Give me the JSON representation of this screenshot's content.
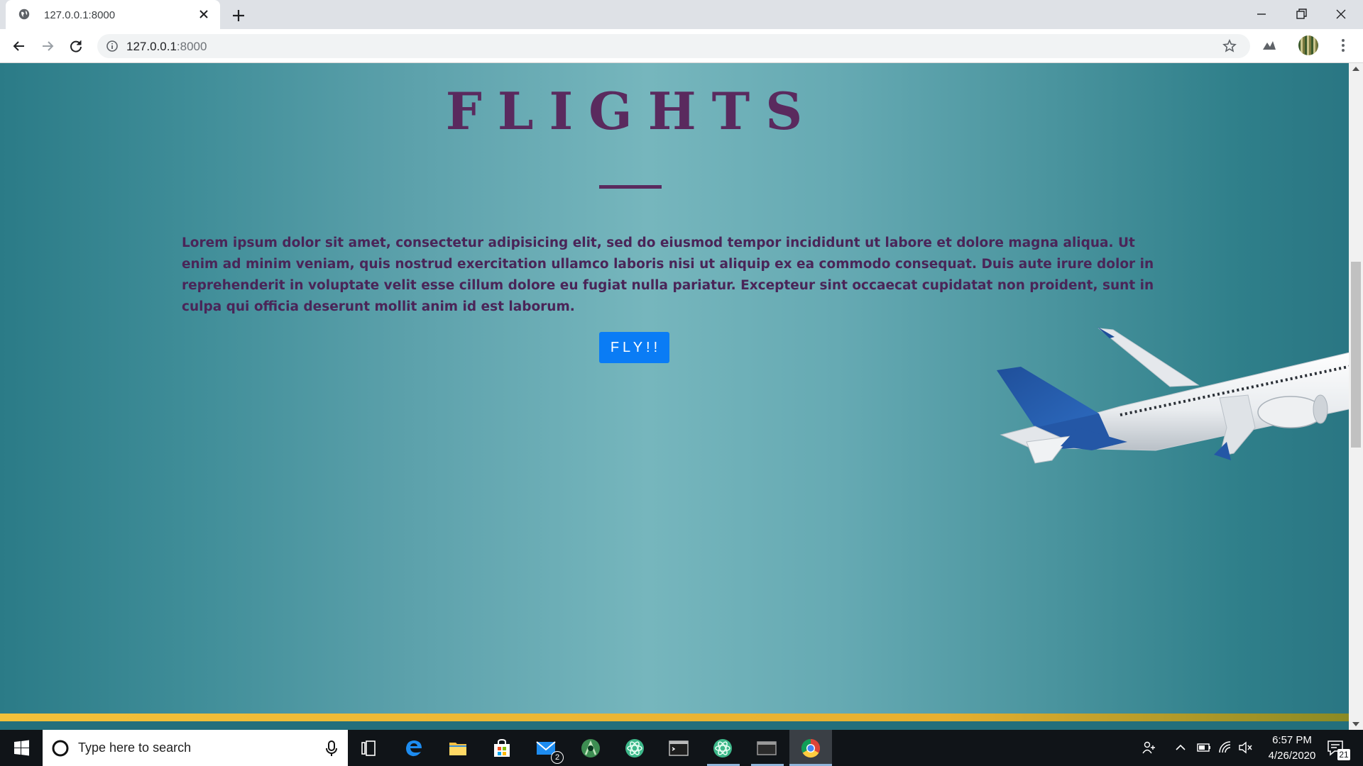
{
  "browser": {
    "tab_title": "127.0.0.1:8000",
    "url_host": "127.0.0.1",
    "url_port": ":8000"
  },
  "page": {
    "heading": "FLIGHTS",
    "body_text": "Lorem ipsum dolor sit amet, consectetur adipisicing elit, sed do eiusmod tempor incididunt ut labore et dolore magna aliqua. Ut enim ad minim veniam, quis nostrud exercitation ullamco laboris nisi ut aliquip ex ea commodo consequat. Duis aute irure dolor in reprehenderit in voluptate velit esse cillum dolore eu fugiat nulla pariatur. Excepteur sint occaecat cupidatat non proident, sunt in culpa qui officia deserunt mollit anim id est laborum.",
    "button_label": "FLY!!"
  },
  "taskbar": {
    "search_placeholder": "Type here to search",
    "mail_badge": "2",
    "time": "6:57 PM",
    "date": "4/26/2020",
    "notification_count": "21",
    "pinned_apps": [
      "task-view",
      "edge",
      "file-explorer",
      "store",
      "mail",
      "android-studio",
      "atom",
      "terminal",
      "atom",
      "console",
      "chrome"
    ]
  },
  "colors": {
    "heading": "#5a2a5e",
    "body_text": "#4a2558",
    "button_bg": "#0a7cf5",
    "page_gradient_edge": "#2a7683",
    "page_gradient_center": "#76b6bd"
  }
}
